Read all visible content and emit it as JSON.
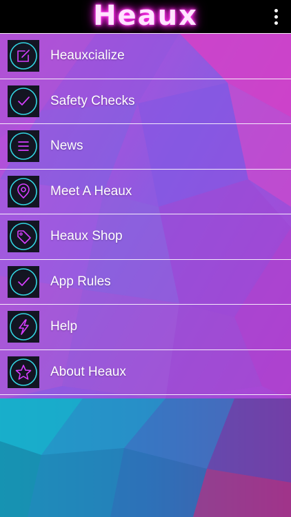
{
  "header": {
    "title": "Heaux",
    "overflow_icon": "more-vertical-icon"
  },
  "colors": {
    "title_glow": "#ff2ee8",
    "icon_ring": "#33d6e3",
    "icon_glyph": "#d63fff",
    "icon_box": "#131522"
  },
  "menu": {
    "items": [
      {
        "label": "Heauxcialize",
        "icon": "edit-icon"
      },
      {
        "label": "Safety Checks",
        "icon": "check-icon"
      },
      {
        "label": "News",
        "icon": "menu-lines-icon"
      },
      {
        "label": "Meet A Heaux",
        "icon": "location-pin-icon"
      },
      {
        "label": "Heaux Shop",
        "icon": "tag-icon"
      },
      {
        "label": "App Rules",
        "icon": "check-icon"
      },
      {
        "label": "Help",
        "icon": "lightning-icon"
      },
      {
        "label": "About Heaux",
        "icon": "star-icon"
      }
    ]
  }
}
